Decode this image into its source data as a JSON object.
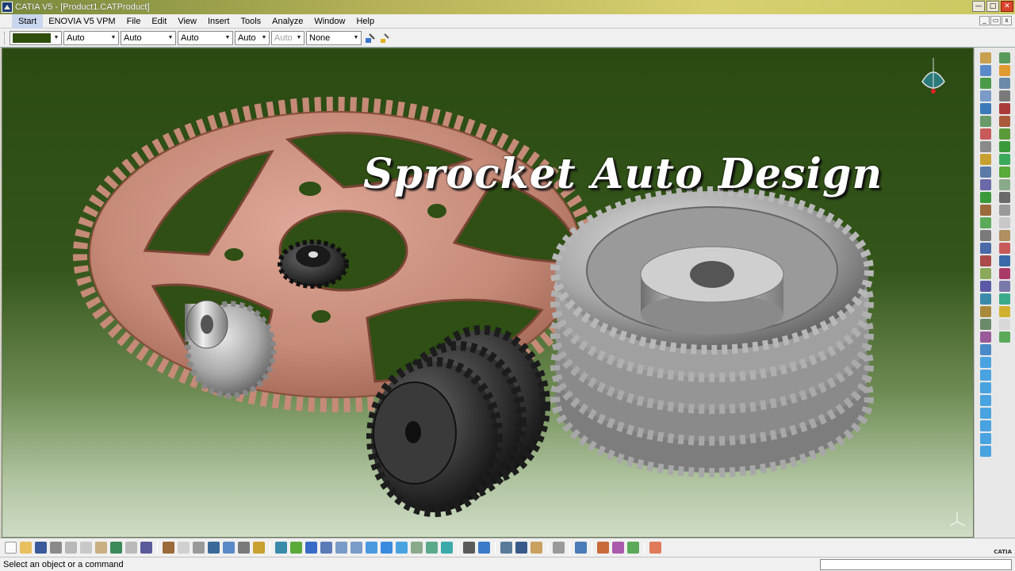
{
  "window": {
    "title": "CATIA V5 - [Product1.CATProduct]",
    "controls": [
      "minimize",
      "maximize",
      "close"
    ]
  },
  "menu": {
    "items": [
      "Start",
      "ENOVIA V5 VPM",
      "File",
      "Edit",
      "View",
      "Insert",
      "Tools",
      "Analyze",
      "Window",
      "Help"
    ]
  },
  "properties_toolbar": {
    "fill_color": "#2f4f0f",
    "transparency": "Auto",
    "line_thickness": "Auto",
    "line_type": "Auto",
    "point_symbol": "Auto",
    "rendering_style": "Auto",
    "layer": "None"
  },
  "viewport": {
    "banner_text": "Sprocket Auto Design",
    "background_top": "#2a4a12",
    "background_bottom": "#cfdcc6"
  },
  "status": {
    "message": "Select an object or a command",
    "command_input": ""
  },
  "colors": {
    "copper_sprocket": "#c58a78",
    "steel_sprocket": "#a8a8a8",
    "dark_sprocket": "#2c2c2c",
    "menu_highlight": "#c9d6ee"
  },
  "branding": {
    "logo_text": "CATIA"
  }
}
